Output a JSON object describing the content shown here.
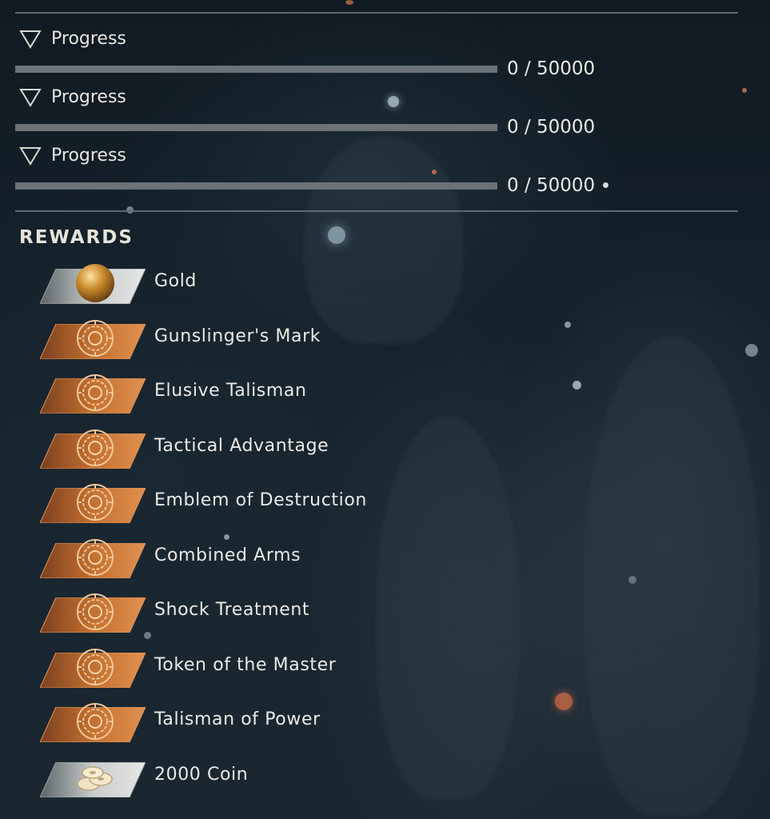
{
  "progress_rows": [
    {
      "label": "Progress",
      "value_text": "0 / 50000",
      "current": 0,
      "max": 50000
    },
    {
      "label": "Progress",
      "value_text": "0 / 50000",
      "current": 0,
      "max": 50000
    },
    {
      "label": "Progress",
      "value_text": "0 / 50000",
      "current": 0,
      "max": 50000
    }
  ],
  "rewards": {
    "title": "REWARDS",
    "items": [
      {
        "label": "Gold",
        "icon": "gold-orb-icon",
        "kind": "gold"
      },
      {
        "label": "Gunslinger's Mark",
        "icon": "inscription-emblem-icon",
        "kind": "emblem"
      },
      {
        "label": "Elusive Talisman",
        "icon": "inscription-emblem-icon",
        "kind": "emblem"
      },
      {
        "label": "Tactical Advantage",
        "icon": "inscription-emblem-icon",
        "kind": "emblem"
      },
      {
        "label": "Emblem of Destruction",
        "icon": "inscription-emblem-icon",
        "kind": "emblem"
      },
      {
        "label": "Combined Arms",
        "icon": "inscription-emblem-icon",
        "kind": "emblem"
      },
      {
        "label": "Shock Treatment",
        "icon": "inscription-emblem-icon",
        "kind": "emblem"
      },
      {
        "label": "Token of the Master",
        "icon": "inscription-emblem-icon",
        "kind": "emblem"
      },
      {
        "label": "Talisman of Power",
        "icon": "inscription-emblem-icon",
        "kind": "emblem"
      },
      {
        "label": "2000 Coin",
        "icon": "coin-stack-icon",
        "kind": "coin"
      }
    ]
  },
  "colors": {
    "accent_orange": "#c8773a",
    "gold": "#c98a2e",
    "plate_silver": "#cfd2d0",
    "text": "#eceae5",
    "bar_track": "#6c7276"
  }
}
